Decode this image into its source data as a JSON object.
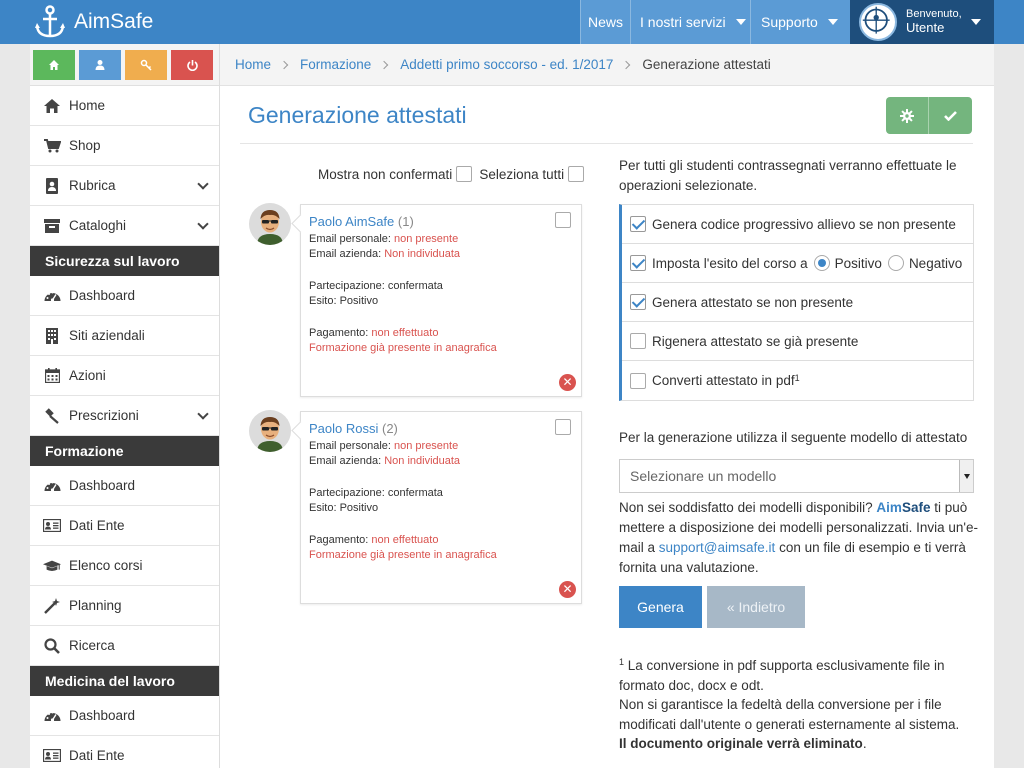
{
  "brand": {
    "name": "AimSafe"
  },
  "topnav": {
    "news": "News",
    "servizi": "I nostri servizi",
    "supporto": "Supporto",
    "welcome": "Benvenuto,",
    "user": "Utente"
  },
  "quick_actions": [
    {
      "icon": "home-icon",
      "color": "#5cb85c"
    },
    {
      "icon": "user-icon",
      "color": "#5b9bd5"
    },
    {
      "icon": "key-icon",
      "color": "#f0ad4e"
    },
    {
      "icon": "power-icon",
      "color": "#d9534f"
    }
  ],
  "sidebar": {
    "top_items": [
      "Home",
      "Shop",
      "Rubrica",
      "Cataloghi"
    ],
    "sections": [
      {
        "title": "Sicurezza sul lavoro",
        "items": [
          "Dashboard",
          "Siti aziendali",
          "Azioni",
          "Prescrizioni"
        ]
      },
      {
        "title": "Formazione",
        "items": [
          "Dashboard",
          "Dati Ente",
          "Elenco corsi",
          "Planning",
          "Ricerca"
        ]
      },
      {
        "title": "Medicina del lavoro",
        "items": [
          "Dashboard",
          "Dati Ente"
        ]
      }
    ]
  },
  "breadcrumb": [
    "Home",
    "Formazione",
    "Addetti primo soccorso - ed. 1/2017",
    "Generazione attestati"
  ],
  "page_title": "Generazione attestati",
  "filters": {
    "show_unconfirmed": "Mostra non confermati",
    "select_all": "Seleziona tutti"
  },
  "students": [
    {
      "name": "Paolo AimSafe",
      "num": "(1)",
      "email_personal_label": "Email personale:",
      "email_personal": "non presente",
      "email_company_label": "Email azienda:",
      "email_company": "Non individuata",
      "participation": "Partecipazione: confermata",
      "outcome": "Esito: Positivo",
      "payment_label": "Pagamento:",
      "payment": "non effettuato",
      "note": "Formazione già presente in anagrafica"
    },
    {
      "name": "Paolo Rossi",
      "num": "(2)",
      "email_personal_label": "Email personale:",
      "email_personal": "non presente",
      "email_company_label": "Email azienda:",
      "email_company": "Non individuata",
      "participation": "Partecipazione: confermata",
      "outcome": "Esito: Positivo",
      "payment_label": "Pagamento:",
      "payment": "non effettuato",
      "note": "Formazione già presente in anagrafica"
    }
  ],
  "intro": "Per tutti gli studenti contrassegnati verranno effettuate le operazioni selezionate.",
  "options": {
    "opt1": "Genera codice progressivo allievo se non presente",
    "opt2": "Imposta l'esito del corso a",
    "positivo": "Positivo",
    "negativo": "Negativo",
    "opt3": "Genera attestato se non presente",
    "opt4": "Rigenera attestato se già presente",
    "opt5": "Converti attestato in pdf",
    "opt5_sup": "1"
  },
  "model": {
    "label": "Per la generazione utilizza il seguente modello di attestato",
    "placeholder": "Selezionare un modello"
  },
  "help": {
    "pre": "Non sei soddisfatto dei modelli disponibili?",
    "aim": "Aim",
    "safe": "Safe",
    "mid": "ti può mettere a disposizione dei modelli personalizzati. Invia un'e-mail a",
    "email": "support@aimsafe.it",
    "post": "con un file di esempio e ti verrà fornita una valutazione."
  },
  "buttons": {
    "genera": "Genera",
    "indietro": "« Indietro"
  },
  "footnote": {
    "sup": "1",
    "line1": "La conversione in pdf supporta esclusivamente file in formato doc, docx e odt.",
    "line2": "Non si garantisce la fedeltà della conversione per i file modificati dall'utente o generati esternamente al sistema.",
    "line3": "Il documento originale verrà eliminato"
  }
}
